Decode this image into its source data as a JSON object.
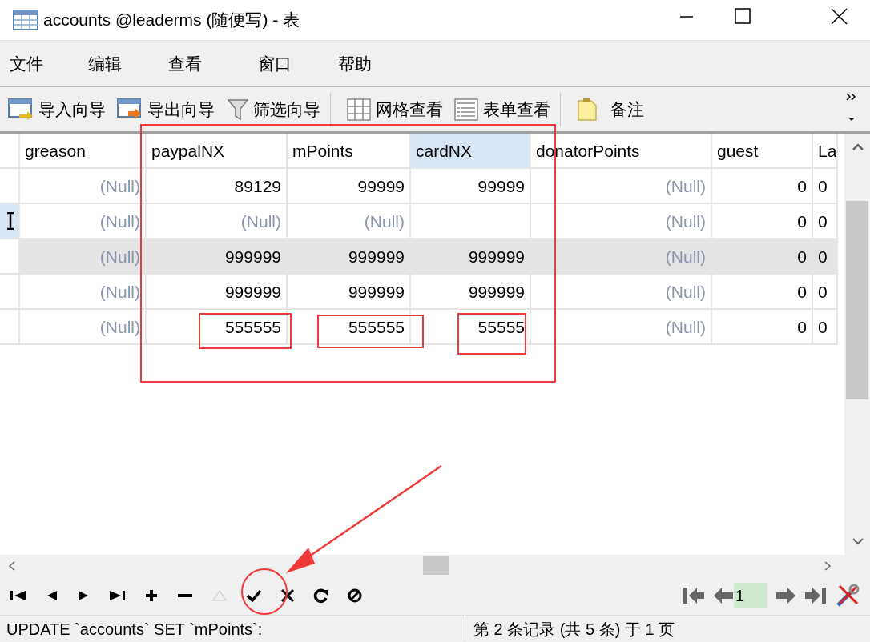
{
  "window": {
    "title": "accounts @leaderms (随便写) - 表"
  },
  "menu": [
    "文件",
    "编辑",
    "查看",
    "窗口",
    "帮助"
  ],
  "toolbar": [
    {
      "kind": "import",
      "label": "导入向导"
    },
    {
      "kind": "export",
      "label": "导出向导"
    },
    {
      "kind": "filter",
      "label": "筛选向导"
    },
    {
      "kind": "grid",
      "label": "网格查看"
    },
    {
      "kind": "form",
      "label": "表单查看"
    },
    {
      "kind": "note",
      "label": "备注"
    }
  ],
  "table": {
    "columns": [
      {
        "label": "greason",
        "selected": false
      },
      {
        "label": "paypalNX",
        "selected": false
      },
      {
        "label": "mPoints",
        "selected": false
      },
      {
        "label": "cardNX",
        "selected": true
      },
      {
        "label": "donatorPoints",
        "selected": false
      },
      {
        "label": "guest",
        "selected": false
      },
      {
        "label": "La",
        "selected": false
      }
    ],
    "rows": [
      {
        "current": false,
        "selected": false,
        "cells": [
          {
            "v": "(Null)",
            "null": true
          },
          {
            "v": "89129"
          },
          {
            "v": "99999"
          },
          {
            "v": "99999"
          },
          {
            "v": "(Null)",
            "null": true
          },
          {
            "v": "0"
          },
          {
            "v": "0"
          }
        ]
      },
      {
        "current": true,
        "selected": false,
        "cells": [
          {
            "v": "(Null)",
            "null": true
          },
          {
            "v": "(Null)",
            "null": true
          },
          {
            "v": "(Null)",
            "null": true
          },
          {},
          {
            "v": "(Null)",
            "null": true
          },
          {
            "v": "0"
          },
          {
            "v": "0"
          }
        ]
      },
      {
        "current": false,
        "selected": true,
        "cells": [
          {
            "v": "(Null)",
            "null": true
          },
          {
            "v": "999999"
          },
          {
            "v": "999999"
          },
          {
            "v": "999999"
          },
          {
            "v": "(Null)",
            "null": true
          },
          {
            "v": "0"
          },
          {
            "v": "0"
          }
        ]
      },
      {
        "current": false,
        "selected": false,
        "cells": [
          {
            "v": "(Null)",
            "null": true
          },
          {
            "v": "999999"
          },
          {
            "v": "999999"
          },
          {
            "v": "999999"
          },
          {
            "v": "(Null)",
            "null": true
          },
          {
            "v": "0"
          },
          {
            "v": "0"
          }
        ]
      },
      {
        "current": false,
        "selected": false,
        "cells": [
          {
            "v": "(Null)",
            "null": true
          },
          {
            "v": "555555"
          },
          {
            "v": "555555"
          },
          {
            "v": "55555"
          },
          {
            "v": "(Null)",
            "null": true
          },
          {
            "v": "0"
          },
          {
            "v": "0"
          }
        ]
      }
    ]
  },
  "pager": {
    "page": "1"
  },
  "status_bar": {
    "sql": "UPDATE `accounts` SET `mPoints`:",
    "record": "第 2 条记录 (共 5 条) 于 1 页"
  }
}
